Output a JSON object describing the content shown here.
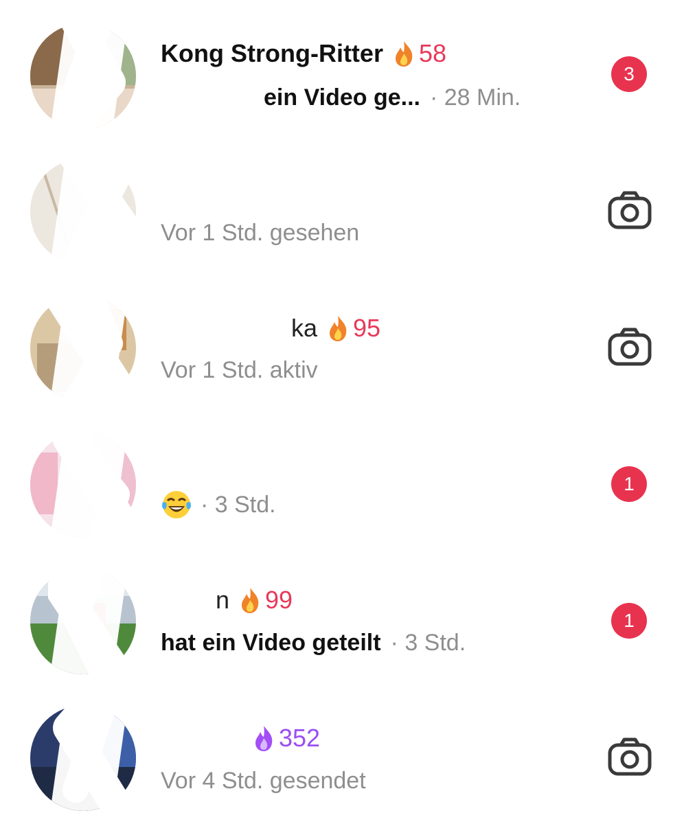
{
  "conversations": [
    {
      "name": "Kong Strong-Ritter",
      "streak": "58",
      "streak_color": "#e8385a",
      "subtitle_strong": "ein Video ge...",
      "subtitle_meta": "· 28 Min.",
      "unread_count": "3",
      "trailing_icon": "unread-badge"
    },
    {
      "name": "",
      "subtitle": "Vor 1 Std. gesehen",
      "trailing_icon": "camera-icon"
    },
    {
      "name": "ka",
      "streak": "95",
      "streak_color": "#e8385a",
      "subtitle": "Vor 1 Std. aktiv",
      "trailing_icon": "camera-icon"
    },
    {
      "name": "",
      "subtitle_emoji": "tears-of-joy-emoji",
      "subtitle_meta": "· 3 Std.",
      "unread_count": "1",
      "trailing_icon": "unread-badge"
    },
    {
      "name": "n",
      "streak": "99",
      "streak_color": "#e8385a",
      "subtitle_strong": "hat ein Video geteilt",
      "subtitle_meta": "· 3 Std.",
      "unread_count": "1",
      "trailing_icon": "unread-badge"
    },
    {
      "name": "",
      "streak": "352",
      "streak_color": "#9a4ff0",
      "subtitle": "Vor 4 Std. gesendet",
      "trailing_icon": "camera-icon"
    }
  ],
  "colors": {
    "badge": "#e8334f",
    "secondary_text": "#8e8e8e",
    "primary_text": "#111111"
  }
}
